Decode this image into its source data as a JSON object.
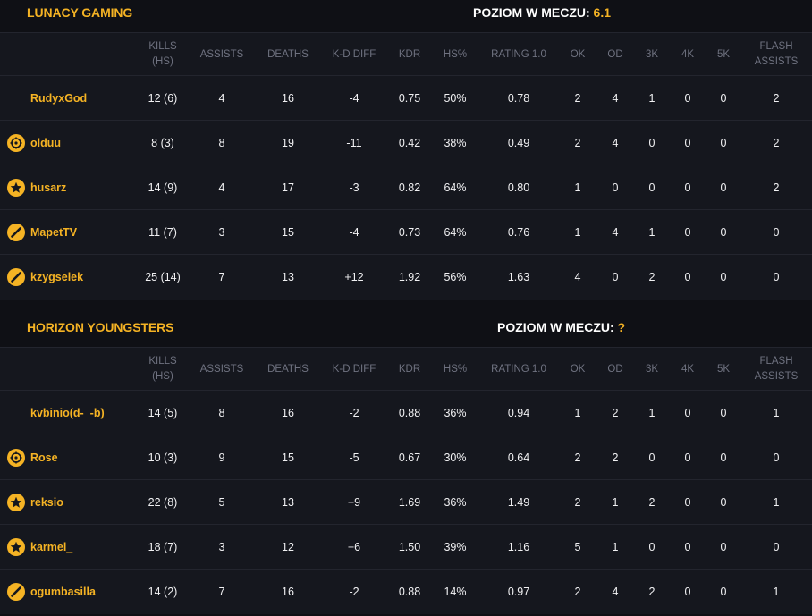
{
  "columns": [
    {
      "key": "kills",
      "label": "KILLS\n(HS)"
    },
    {
      "key": "assists",
      "label": "ASSISTS"
    },
    {
      "key": "deaths",
      "label": "DEATHS"
    },
    {
      "key": "kd_diff",
      "label": "K-D DIFF"
    },
    {
      "key": "kdr",
      "label": "KDR"
    },
    {
      "key": "hs",
      "label": "HS%"
    },
    {
      "key": "rating",
      "label": "RATING 1.0"
    },
    {
      "key": "ok",
      "label": "OK"
    },
    {
      "key": "od",
      "label": "OD"
    },
    {
      "key": "k3",
      "label": "3K"
    },
    {
      "key": "k4",
      "label": "4K"
    },
    {
      "key": "k5",
      "label": "5K"
    },
    {
      "key": "flash",
      "label": "FLASH\nASSISTS"
    }
  ],
  "teams": [
    {
      "name": "LUNACY GAMING",
      "level_label": "POZIOM W MECZU:",
      "level_value": "6.1",
      "players": [
        {
          "name": "RudyxGod",
          "icon": "none",
          "kills": "12 (6)",
          "assists": "4",
          "deaths": "16",
          "kd_diff": "-4",
          "kdr": "0.75",
          "hs": "50%",
          "rating": "0.78",
          "ok": "2",
          "od": "4",
          "k3": "1",
          "k4": "0",
          "k5": "0",
          "flash": "2"
        },
        {
          "name": "olduu",
          "icon": "crosshair-icon",
          "kills": "8 (3)",
          "assists": "8",
          "deaths": "19",
          "kd_diff": "-11",
          "kdr": "0.42",
          "hs": "38%",
          "rating": "0.49",
          "ok": "2",
          "od": "4",
          "k3": "0",
          "k4": "0",
          "k5": "0",
          "flash": "2"
        },
        {
          "name": "husarz",
          "icon": "star-icon",
          "kills": "14 (9)",
          "assists": "4",
          "deaths": "17",
          "kd_diff": "-3",
          "kdr": "0.82",
          "hs": "64%",
          "rating": "0.80",
          "ok": "1",
          "od": "0",
          "k3": "0",
          "k4": "0",
          "k5": "0",
          "flash": "2"
        },
        {
          "name": "MapetTV",
          "icon": "slash-icon",
          "kills": "11 (7)",
          "assists": "3",
          "deaths": "15",
          "kd_diff": "-4",
          "kdr": "0.73",
          "hs": "64%",
          "rating": "0.76",
          "ok": "1",
          "od": "4",
          "k3": "1",
          "k4": "0",
          "k5": "0",
          "flash": "0"
        },
        {
          "name": "kzygselek",
          "icon": "slash-icon",
          "kills": "25 (14)",
          "assists": "7",
          "deaths": "13",
          "kd_diff": "+12",
          "kdr": "1.92",
          "hs": "56%",
          "rating": "1.63",
          "ok": "4",
          "od": "0",
          "k3": "2",
          "k4": "0",
          "k5": "0",
          "flash": "0"
        }
      ]
    },
    {
      "name": "HORIZON YOUNGSTERS",
      "level_label": "POZIOM W MECZU:",
      "level_value": "?",
      "players": [
        {
          "name": "kvbinio(d-_-b)",
          "icon": "none",
          "kills": "14 (5)",
          "assists": "8",
          "deaths": "16",
          "kd_diff": "-2",
          "kdr": "0.88",
          "hs": "36%",
          "rating": "0.94",
          "ok": "1",
          "od": "2",
          "k3": "1",
          "k4": "0",
          "k5": "0",
          "flash": "1"
        },
        {
          "name": "Rose",
          "icon": "crosshair-icon",
          "kills": "10 (3)",
          "assists": "9",
          "deaths": "15",
          "kd_diff": "-5",
          "kdr": "0.67",
          "hs": "30%",
          "rating": "0.64",
          "ok": "2",
          "od": "2",
          "k3": "0",
          "k4": "0",
          "k5": "0",
          "flash": "0"
        },
        {
          "name": "reksio",
          "icon": "star-icon",
          "kills": "22 (8)",
          "assists": "5",
          "deaths": "13",
          "kd_diff": "+9",
          "kdr": "1.69",
          "hs": "36%",
          "rating": "1.49",
          "ok": "2",
          "od": "1",
          "k3": "2",
          "k4": "0",
          "k5": "0",
          "flash": "1"
        },
        {
          "name": "karmel_",
          "icon": "star-icon",
          "kills": "18 (7)",
          "assists": "3",
          "deaths": "12",
          "kd_diff": "+6",
          "kdr": "1.50",
          "hs": "39%",
          "rating": "1.16",
          "ok": "5",
          "od": "1",
          "k3": "0",
          "k4": "0",
          "k5": "0",
          "flash": "0"
        },
        {
          "name": "ogumbasilla",
          "icon": "slash-icon",
          "kills": "14 (2)",
          "assists": "7",
          "deaths": "16",
          "kd_diff": "-2",
          "kdr": "0.88",
          "hs": "14%",
          "rating": "0.97",
          "ok": "2",
          "od": "4",
          "k3": "2",
          "k4": "0",
          "k5": "0",
          "flash": "1"
        }
      ]
    }
  ],
  "colors": {
    "accent": "#f5b324",
    "background": "#0f1015",
    "panel": "#15171e",
    "header_text": "#6f7280",
    "value_text": "#f1f1f3"
  }
}
